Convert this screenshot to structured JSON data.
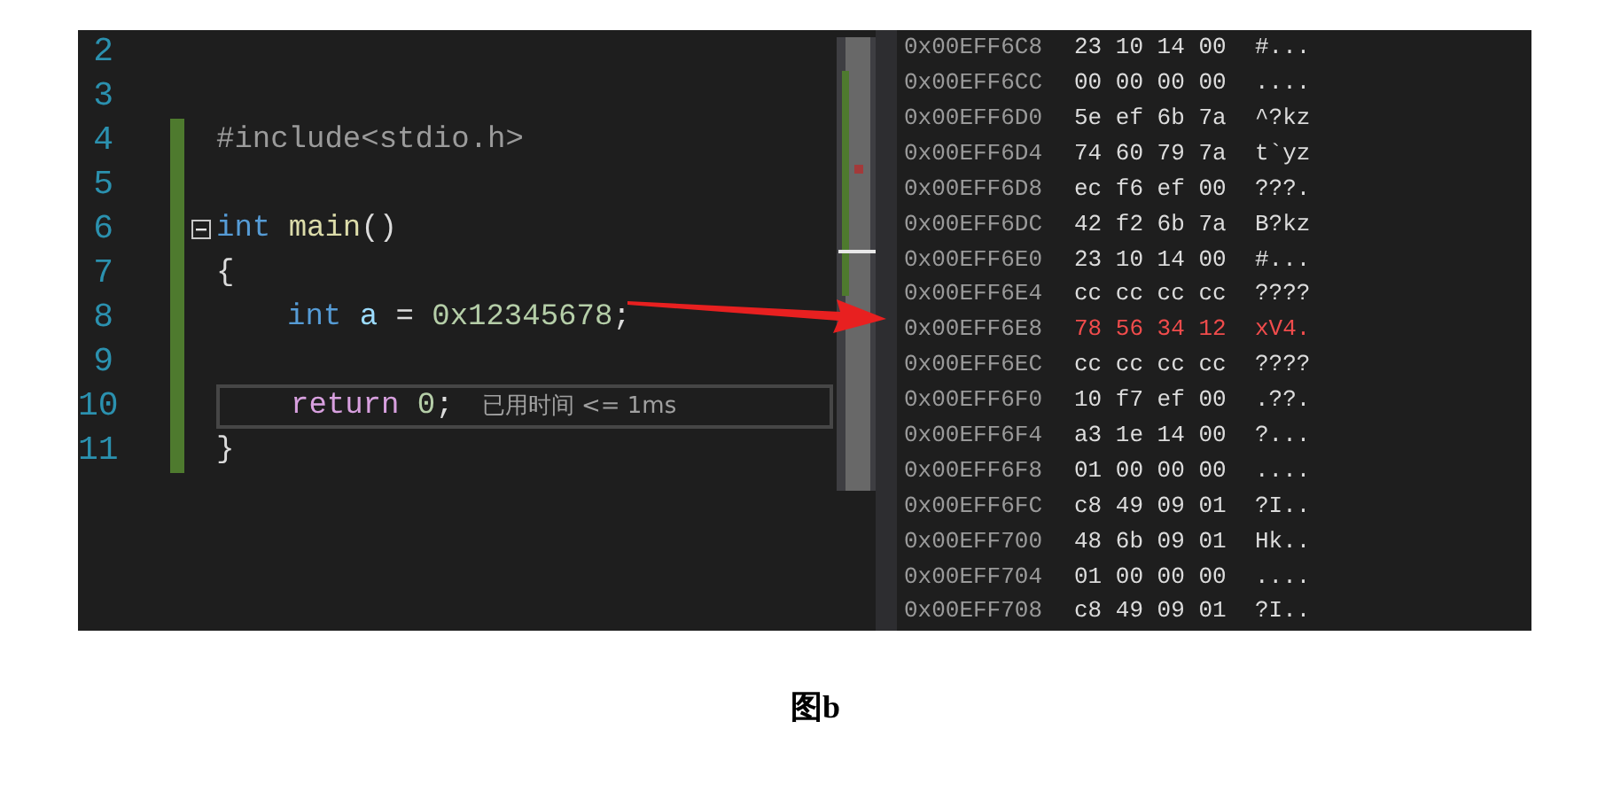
{
  "editor": {
    "lines": [
      {
        "number": "2"
      },
      {
        "number": "3"
      },
      {
        "number": "4",
        "changed": true,
        "nested": false,
        "tokens": [
          {
            "kind": "preprocessor",
            "text": "#include<stdio.h>"
          }
        ]
      },
      {
        "number": "5",
        "changed": true
      },
      {
        "number": "6",
        "changed": true,
        "fold_toggle": true,
        "nested": false,
        "tokens": [
          {
            "kind": "keyword",
            "text": "int "
          },
          {
            "kind": "function",
            "text": "main"
          },
          {
            "kind": "plain",
            "text": "()"
          }
        ]
      },
      {
        "number": "7",
        "changed": true,
        "nested": false,
        "tokens": [
          {
            "kind": "plain",
            "text": "{"
          }
        ]
      },
      {
        "number": "8",
        "changed": true,
        "nested": true,
        "tokens": [
          {
            "kind": "keyword",
            "text": "int "
          },
          {
            "kind": "variable",
            "text": "a"
          },
          {
            "kind": "plain",
            "text": " = "
          },
          {
            "kind": "number",
            "text": "0x12345678"
          },
          {
            "kind": "plain",
            "text": ";"
          }
        ]
      },
      {
        "number": "9",
        "changed": true
      },
      {
        "number": "10",
        "changed": true,
        "current": true,
        "nested": true,
        "tokens": [
          {
            "kind": "control",
            "text": "return "
          },
          {
            "kind": "number",
            "text": "0"
          },
          {
            "kind": "plain",
            "text": ";"
          }
        ],
        "hint": "已用时间 <= 1ms"
      },
      {
        "number": "11",
        "changed": true,
        "nested": false,
        "tokens": [
          {
            "kind": "plain",
            "text": "}"
          }
        ]
      }
    ]
  },
  "memory": {
    "rows": [
      {
        "address": "0x00EFF6C8",
        "bytes": "23 10 14 00",
        "ascii": "#...",
        "changed": false
      },
      {
        "address": "0x00EFF6CC",
        "bytes": "00 00 00 00",
        "ascii": "....",
        "changed": false
      },
      {
        "address": "0x00EFF6D0",
        "bytes": "5e ef 6b 7a",
        "ascii": "^?kz",
        "changed": false
      },
      {
        "address": "0x00EFF6D4",
        "bytes": "74 60 79 7a",
        "ascii": "t`yz",
        "changed": false
      },
      {
        "address": "0x00EFF6D8",
        "bytes": "ec f6 ef 00",
        "ascii": "???.",
        "changed": false
      },
      {
        "address": "0x00EFF6DC",
        "bytes": "42 f2 6b 7a",
        "ascii": "B?kz",
        "changed": false
      },
      {
        "address": "0x00EFF6E0",
        "bytes": "23 10 14 00",
        "ascii": "#...",
        "changed": false
      },
      {
        "address": "0x00EFF6E4",
        "bytes": "cc cc cc cc",
        "ascii": "????",
        "changed": false
      },
      {
        "address": "0x00EFF6E8",
        "bytes": "78 56 34 12",
        "ascii": "xV4.",
        "changed": true
      },
      {
        "address": "0x00EFF6EC",
        "bytes": "cc cc cc cc",
        "ascii": "????",
        "changed": false
      },
      {
        "address": "0x00EFF6F0",
        "bytes": "10 f7 ef 00",
        "ascii": ".??.",
        "changed": false
      },
      {
        "address": "0x00EFF6F4",
        "bytes": "a3 1e 14 00",
        "ascii": "?...",
        "changed": false
      },
      {
        "address": "0x00EFF6F8",
        "bytes": "01 00 00 00",
        "ascii": "....",
        "changed": false
      },
      {
        "address": "0x00EFF6FC",
        "bytes": "c8 49 09 01",
        "ascii": "?I..",
        "changed": false
      },
      {
        "address": "0x00EFF700",
        "bytes": "48 6b 09 01",
        "ascii": "Hk..",
        "changed": false
      },
      {
        "address": "0x00EFF704",
        "bytes": "01 00 00 00",
        "ascii": "....",
        "changed": false
      },
      {
        "address": "0x00EFF708",
        "bytes": "c8 49 09 01",
        "ascii": "?I..",
        "changed": false
      }
    ]
  },
  "caption": "图b"
}
